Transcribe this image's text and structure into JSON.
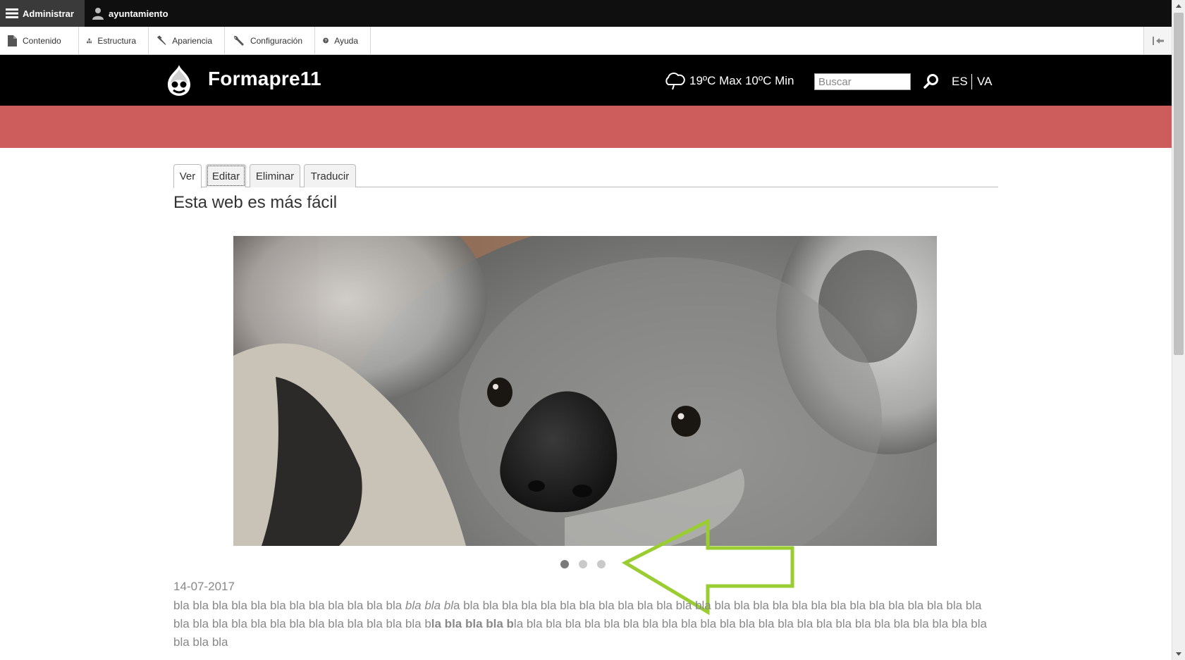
{
  "admin_bar": {
    "manage_label": "Administrar",
    "user_label": "ayuntamiento"
  },
  "tray": {
    "items": [
      {
        "label": "Contenido",
        "icon": "file-icon"
      },
      {
        "label": "Estructura",
        "icon": "sitemap-icon"
      },
      {
        "label": "Apariencia",
        "icon": "brush-icon"
      },
      {
        "label": "Configuración",
        "icon": "wrench-icon"
      },
      {
        "label": "Ayuda",
        "icon": "help-icon"
      }
    ],
    "collapse_icon": "collapse-tray-icon"
  },
  "header": {
    "site_name": "Formapre11",
    "weather": "19ºC Max 10ºC Min",
    "search_placeholder": "Buscar",
    "lang_es": "ES",
    "lang_va": "VA"
  },
  "colors": {
    "admin_bg": "#0f0f0f",
    "header_bg": "#000000",
    "band": "#cd5c5c",
    "annotation_arrow": "#9acd32"
  },
  "tabs": [
    {
      "label": "Ver",
      "active": true
    },
    {
      "label": "Editar",
      "active": false
    },
    {
      "label": "Eliminar",
      "active": false
    },
    {
      "label": "Traducir",
      "active": false
    }
  ],
  "page": {
    "title": "Esta web es más fácil",
    "date": "14-07-2017",
    "body": {
      "p1": "bla bla bla bla bla bla bla bla bla bla bla bla ",
      "italic": "bla bla bl",
      "p2": "a bla bla bla bla bla bla bla bla bla bla bla bla bla bla bla bla bla bla bla bla bla bla bla bla bla bla bla bla bla bla bla bla bla bla bla bla bla bla bla bla b",
      "bold": "la bla bla bla b",
      "p3": "la bla bla bla bla bla bla bla bla bla bla bla bla bla bla bla bla bla bla bla bla bla bla bla bla bla bla bla"
    }
  },
  "slideshow": {
    "slide_count": 3,
    "active_index": 0
  }
}
